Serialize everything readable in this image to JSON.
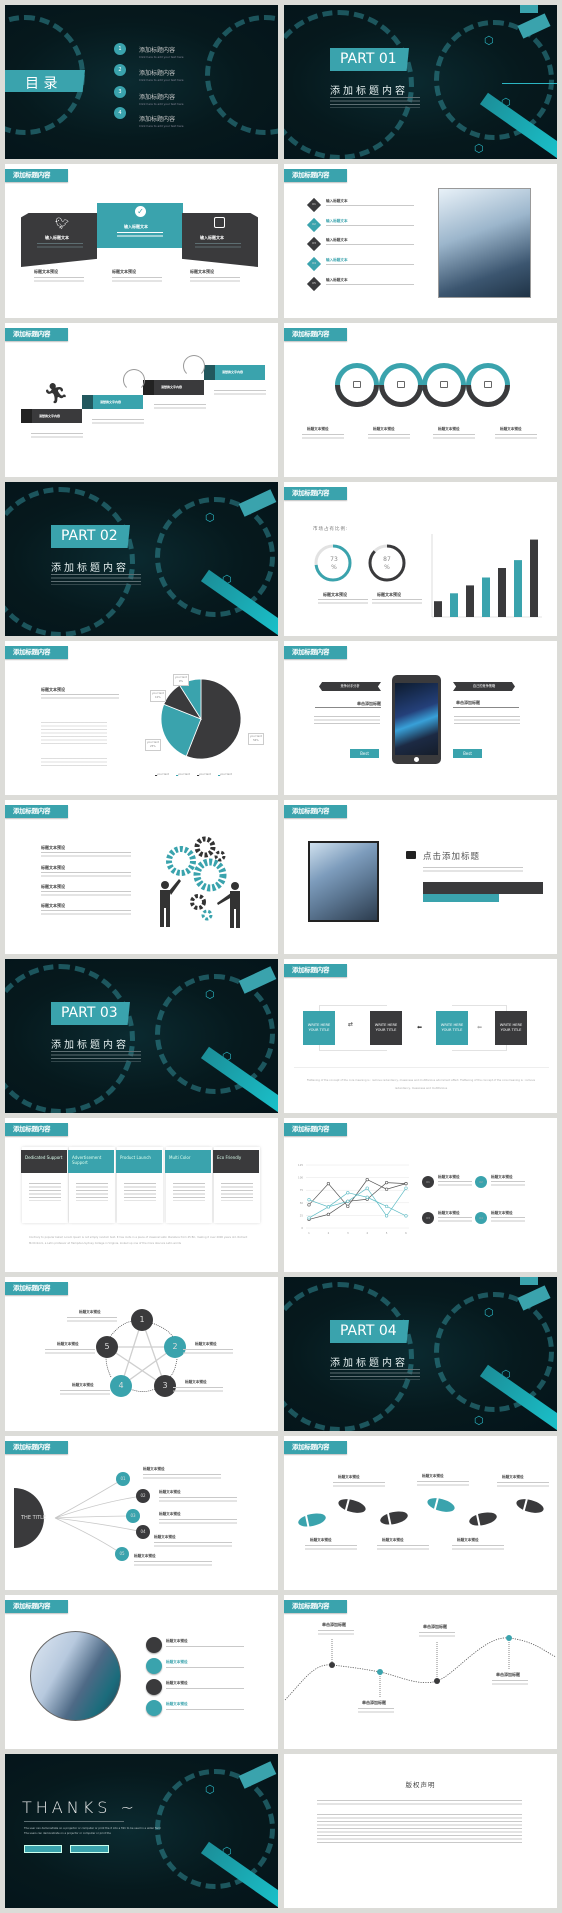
{
  "colors": {
    "accent": "#3aa3ad",
    "dark": "#3a3a3c",
    "dark_bg": "#06191d",
    "page_bg": "#dcdcd8"
  },
  "header_label": "添加标题内容",
  "toc": {
    "title": "目 录",
    "items": [
      {
        "num": "1",
        "title": "添加标题内容",
        "sub": "Click here to add your text here"
      },
      {
        "num": "2",
        "title": "添加标题内容",
        "sub": "Click here to add your text here"
      },
      {
        "num": "3",
        "title": "添加标题内容",
        "sub": "Click here to add your text here"
      },
      {
        "num": "4",
        "title": "添加标题内容",
        "sub": "Click here to add your text here"
      }
    ]
  },
  "parts": [
    {
      "label": "PART 01",
      "title": "添加标题内容"
    },
    {
      "label": "PART 02",
      "title": "添加标题内容"
    },
    {
      "label": "PART 03",
      "title": "添加标题内容"
    },
    {
      "label": "PART 04",
      "title": "添加标题内容"
    }
  ],
  "social": {
    "panels": [
      {
        "icon": "twitter-icon",
        "title": "输入标题文本"
      },
      {
        "icon": "check-icon",
        "title": "输入标题文本"
      },
      {
        "icon": "instagram-icon",
        "title": "输入标题文本"
      }
    ],
    "captions": [
      "标题文本预设",
      "标题文本预设",
      "标题文本预设"
    ]
  },
  "list": {
    "items": [
      {
        "num": "01",
        "title": "输入标题文本"
      },
      {
        "num": "02",
        "title": "输入标题文本"
      },
      {
        "num": "03",
        "title": "输入标题文本"
      },
      {
        "num": "04",
        "title": "输入标题文本"
      },
      {
        "num": "05",
        "title": "输入标题文本"
      }
    ]
  },
  "steps": {
    "labels": [
      "请替换文字内容",
      "请替换文字内容",
      "请替换文字内容",
      "请替换文字内容"
    ]
  },
  "rings": {
    "icons": [
      "radio-icon",
      "printer-icon",
      "scanner-icon",
      "megaphone-icon"
    ],
    "captions": [
      "标题文本预设",
      "标题文本预设",
      "标题文本预设",
      "标题文本预设"
    ]
  },
  "stats": {
    "title": "市场占有比例:",
    "donuts": [
      {
        "value": "73",
        "unit": "%",
        "caption": "标题文本预设"
      },
      {
        "value": "87",
        "unit": "%",
        "caption": "标题文本预设"
      }
    ]
  },
  "pie_slide": {
    "title": "标题文本预设",
    "labels": [
      {
        "name": "your text",
        "pct": "9%"
      },
      {
        "name": "your text",
        "pct": "10%"
      },
      {
        "name": "your text",
        "pct": "25%"
      },
      {
        "name": "your text",
        "pct": "56%"
      }
    ],
    "legend": [
      "your text",
      "your text",
      "your text",
      "your text"
    ]
  },
  "phone": {
    "left_ribbon": "竞争对手分析",
    "right_ribbon": "自己的竞争策略",
    "left_title": "单击添加标题",
    "right_title": "单击添加标题",
    "button": "Best"
  },
  "gears": {
    "titles": [
      "标题文本预设",
      "标题文本预设",
      "标题文本预设",
      "标题文本预设"
    ]
  },
  "photo_slide": {
    "title": "点击添加标题"
  },
  "flow": {
    "box": "WRITE HERE YOUR TITLE",
    "caption": "Flattening of the concept of the core meaning is : remove redundancy, messiness and multifarious adornment effect. Flattening of the concept of the core meaning is : remove redundancy, messiness and multifarious"
  },
  "table": {
    "headers": [
      "Dedicated Support",
      "Advertisement Support",
      "Product Launch",
      "Multi Color",
      "Eco Friendly"
    ],
    "caption": "Contrary to popular belief, Lorem Ipsum is not simply random text. It has roots in a piece of classical Latin literature from 45 BC, making it over 2000 years old. Richard McClintock, a Latin professor at Hampden-Sydney College in Virginia, looked up one of the more obscure Latin words"
  },
  "legend_items": [
    {
      "num": "01",
      "title": "标题文本预设"
    },
    {
      "num": "02",
      "title": "标题文本预设"
    },
    {
      "num": "03",
      "title": "标题文本预设"
    },
    {
      "num": "04",
      "title": "标题文本预设"
    }
  ],
  "pentagon": {
    "nodes": [
      "1",
      "2",
      "3",
      "4",
      "5"
    ],
    "titles": [
      "标题文本预设",
      "标题文本预设",
      "标题文本预设",
      "标题文本预设",
      "标题文本预设"
    ]
  },
  "tree": {
    "root": "THE TITLE",
    "nodes": [
      "01",
      "02",
      "03",
      "04",
      "05"
    ],
    "titles": [
      "标题文本预设",
      "标题文本预设",
      "标题文本预设",
      "标题文本预设",
      "标题文本预设"
    ]
  },
  "footprints": {
    "titles": [
      "标题文本预设",
      "标题文本预设",
      "标题文本预设",
      "标题文本预设",
      "标题文本预设",
      "标题文本预设"
    ]
  },
  "icon_list": {
    "icons": [
      "refresh-icon",
      "calendar-icon",
      "user-icon",
      "pause-icon"
    ],
    "titles": [
      "标题文本预设",
      "标题文本预设",
      "标题文本预设",
      "标题文本预设"
    ]
  },
  "wave": {
    "titles": [
      "单击添加标题",
      "单击添加标题",
      "单击添加标题",
      "单击添加标题"
    ]
  },
  "thanks": {
    "title": "THANKS ~",
    "body": "The user can demonstrate on a projector or computer or print the it into a film to be used in a wider field The users can demonstrate on a projector or computer or print the"
  },
  "copyright": {
    "title": "版权声明"
  },
  "chart_data": [
    {
      "type": "pie",
      "values": [
        56,
        25,
        10,
        9
      ],
      "labels": [
        "56%",
        "25%",
        "10%",
        "9%"
      ]
    },
    {
      "type": "bar",
      "categories": [
        "1",
        "2",
        "3",
        "4",
        "5",
        "6",
        "7"
      ],
      "values": [
        20,
        30,
        40,
        50,
        62,
        72,
        98
      ],
      "ylim": [
        0,
        100
      ],
      "grid": false
    },
    {
      "type": "line",
      "x": [
        1,
        2,
        3,
        4,
        5,
        6
      ],
      "ylim": [
        0,
        125
      ],
      "yticks": [
        0,
        25,
        50,
        75,
        100,
        125
      ],
      "grid": true,
      "series": [
        {
          "values": [
            46,
            88,
            43,
            96,
            77,
            88
          ],
          "color": "#555555"
        },
        {
          "values": [
            17,
            27,
            53,
            57,
            90,
            88
          ],
          "color": "#555555"
        },
        {
          "values": [
            56,
            42,
            53,
            79,
            24,
            79
          ],
          "color": "#5fbcc5"
        },
        {
          "values": [
            20,
            42,
            70,
            61,
            43,
            24
          ],
          "color": "#5fbcc5"
        }
      ]
    }
  ]
}
